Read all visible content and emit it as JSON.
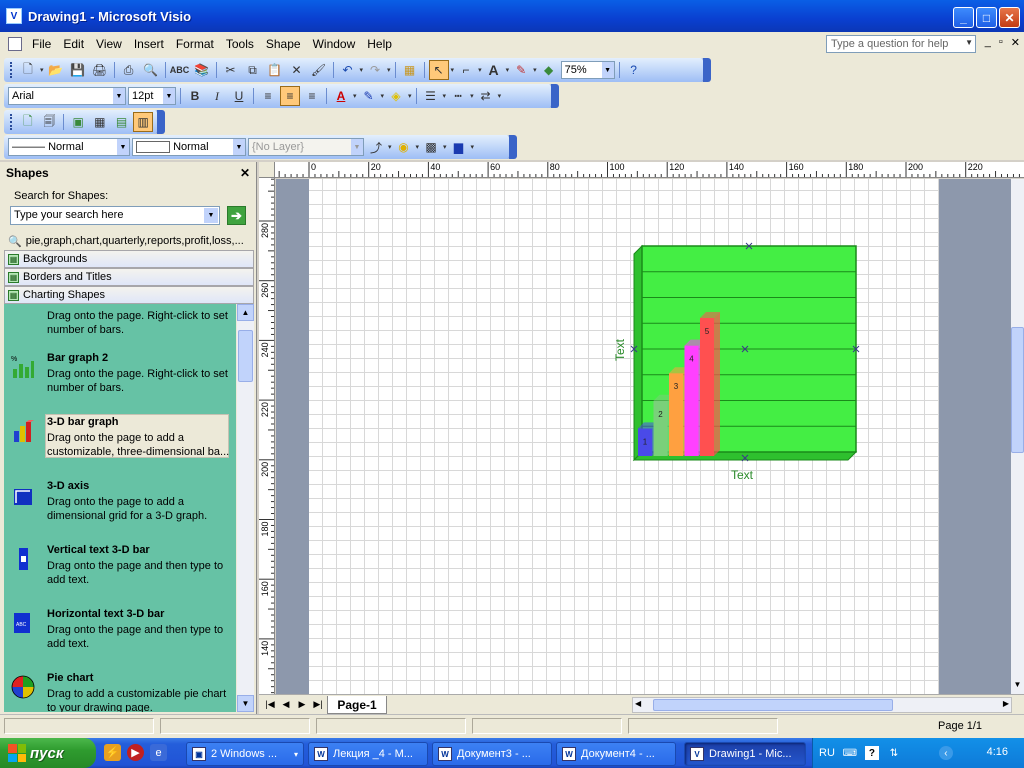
{
  "window": {
    "title": "Drawing1 - Microsoft Visio",
    "min": "_",
    "max": "□",
    "close": "✕"
  },
  "menu": [
    "File",
    "Edit",
    "View",
    "Insert",
    "Format",
    "Tools",
    "Shape",
    "Window",
    "Help"
  ],
  "help_placeholder": "Type a question for help",
  "toolbar": {
    "zoom": "75%",
    "font": "Arial",
    "size": "12pt",
    "bold": "B",
    "italic": "I",
    "underline": "U",
    "line_style": "Normal",
    "fill_style": "Normal",
    "layer": "{No Layer}"
  },
  "shapes_panel": {
    "title": "Shapes",
    "close": "✕",
    "search_label": "Search for Shapes:",
    "search_placeholder": "Type your search here",
    "go": "➔",
    "stencils": [
      "pie,graph,chart,quarterly,reports,profit,loss,...",
      "Backgrounds",
      "Borders and Titles",
      "Charting Shapes"
    ],
    "masters": [
      {
        "name": "",
        "desc": "Drag onto the page. Right-click to set number of bars."
      },
      {
        "name": "Bar graph    2",
        "desc": "Drag onto the page. Right-click to set number of bars."
      },
      {
        "name": "3-D bar graph",
        "desc": "Drag onto the page to add a customizable, three-dimensional ba..."
      },
      {
        "name": "3-D axis",
        "desc": "Drag onto the page to add a dimensional grid for a 3-D graph."
      },
      {
        "name": "Vertical text 3-D bar",
        "desc": "Drag onto the page and then type to add text."
      },
      {
        "name": "Horizontal text 3-D bar",
        "desc": "Drag onto the page and then type to add text."
      },
      {
        "name": "Pie chart",
        "desc": "Drag to add a customizable pie chart to your drawing page."
      }
    ]
  },
  "rulers": {
    "h": [
      "0",
      "20",
      "40",
      "60",
      "80",
      "100",
      "120",
      "140",
      "160",
      "180",
      "200",
      "220"
    ],
    "v": [
      "280",
      "260",
      "240",
      "220",
      "200",
      "180",
      "160",
      "140"
    ]
  },
  "chart": {
    "type": "3-D bar graph",
    "bar_labels": [
      "1",
      "2",
      "3",
      "4",
      "5"
    ],
    "bar_colors": [
      "#4a4ae8",
      "#7ad07a",
      "#ffa040",
      "#ff40ff",
      "#ff5050"
    ],
    "values": [
      1,
      2,
      3,
      4,
      5
    ],
    "ylabel": "Text",
    "xlabel": "Text",
    "background": "#44ee44"
  },
  "page_tab": "Page-1",
  "status": {
    "page": "Page 1/1"
  },
  "taskbar": {
    "start": "пуск",
    "tasks": [
      {
        "label": "2 Windows ...",
        "active": false
      },
      {
        "label": "Лекция _4 - М...",
        "active": false
      },
      {
        "label": "Документ3 - ...",
        "active": false
      },
      {
        "label": "Документ4 - ...",
        "active": false
      },
      {
        "label": "Drawing1 - Mic...",
        "active": true
      }
    ],
    "lang": "RU",
    "clock": "4:16"
  }
}
